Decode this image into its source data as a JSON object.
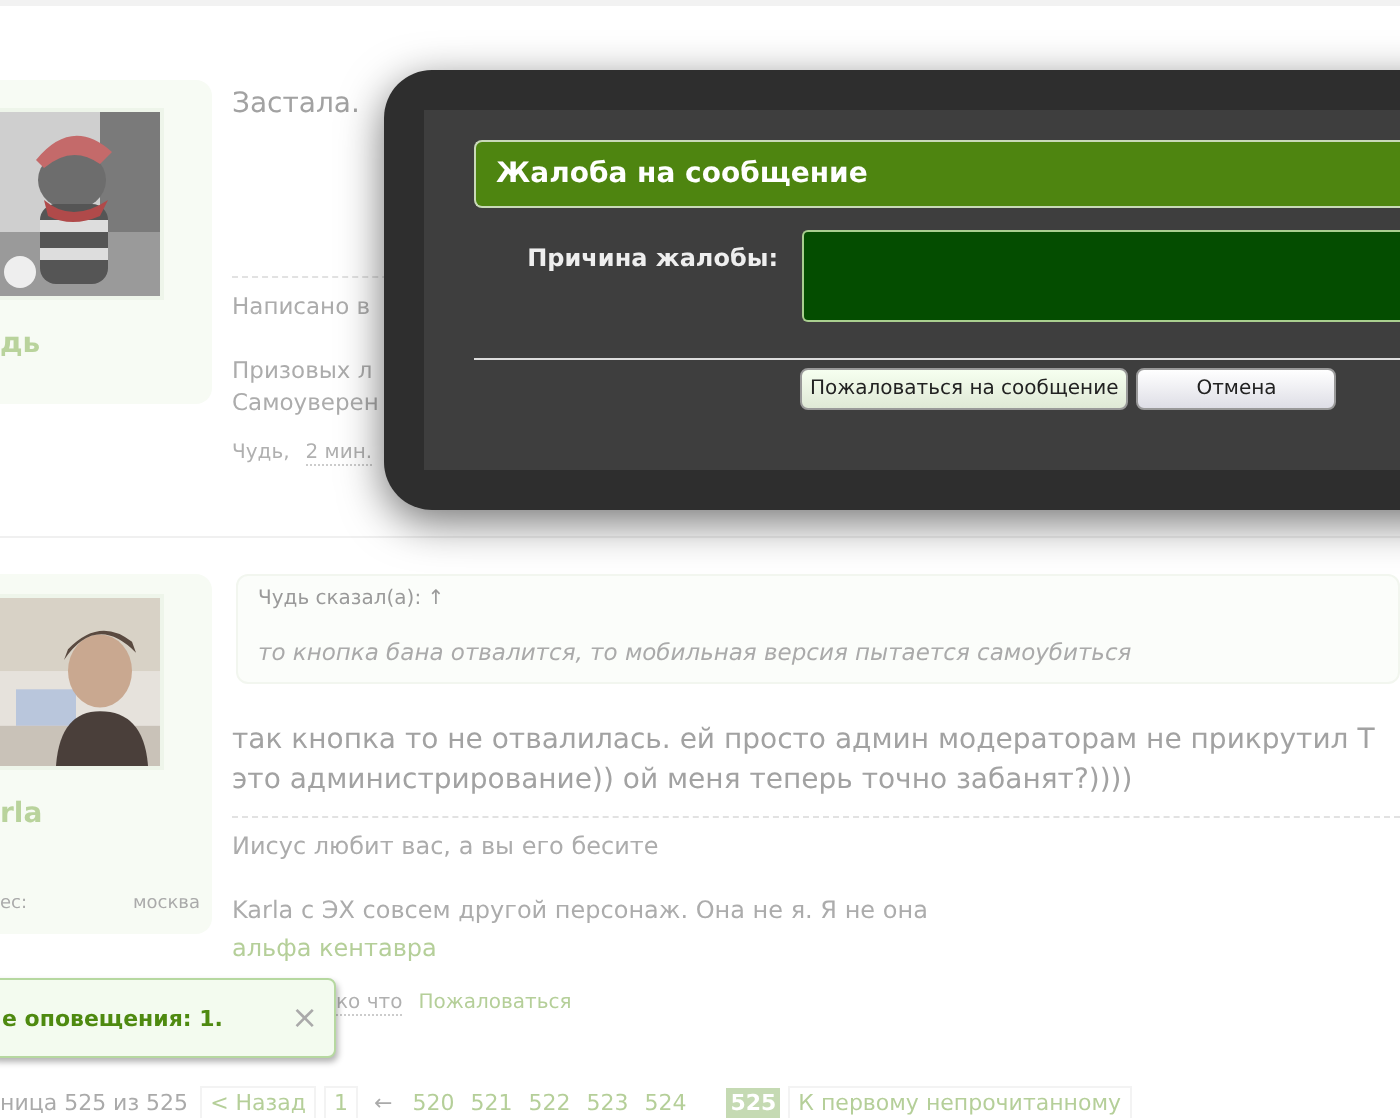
{
  "posts": [
    {
      "author": "дь",
      "message": [
        "Застала."
      ],
      "signature": [
        "Написано в"
      ],
      "signature_2": [
        "Призовых л",
        "Самоуверен"
      ],
      "meta": {
        "author": "Чудь,",
        "date": "2 мин."
      }
    },
    {
      "author": "rla",
      "location_label": "ес:",
      "location": "москва",
      "quote": {
        "header": "Чудь сказал(а): ↑",
        "text": "то кнопка бана отвалится, то мобильная версия пытается самоубиться"
      },
      "message": [
        "так кнопка то не отвалилась. ей просто админ модераторам не прикрутил Т",
        "это администрирование)) ой меня теперь точно забанят?))))"
      ],
      "signature": [
        "Иисус любит вас, а вы его бесите"
      ],
      "signature_2": [
        "Karla с ЭХ совсем другой персонаж. Она не я. Я не она"
      ],
      "signature_link": "альфа кентавра",
      "meta": {
        "date": "ко что",
        "actions": [
          "Пожаловаться"
        ]
      }
    }
  ],
  "notification": {
    "text": "е оповещения: 1.",
    "close": "×"
  },
  "pagination": {
    "label": "ница 525 из 525",
    "prev": "< Назад",
    "first": "1",
    "gap": "←",
    "pages": [
      {
        "label": "520",
        "selected": false
      },
      {
        "label": "521",
        "selected": false
      },
      {
        "label": "522",
        "selected": false
      },
      {
        "label": "523",
        "selected": false
      },
      {
        "label": "524",
        "selected": false
      },
      {
        "label": "525",
        "selected": true
      }
    ],
    "unread": "К первому непрочитанному"
  },
  "dialog": {
    "title": "Жалоба на сообщение",
    "field_label": "Причина жалобы:",
    "buttons": [
      {
        "label": "Пожаловаться на сообщение",
        "kind": "primary"
      },
      {
        "label": "Отмена",
        "kind": "secondary"
      }
    ]
  }
}
